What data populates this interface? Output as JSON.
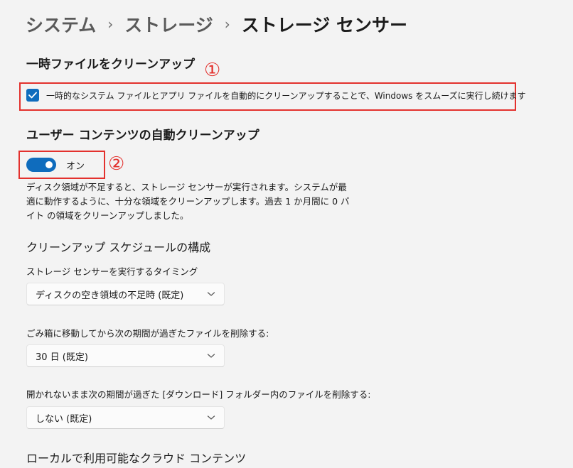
{
  "breadcrumb": {
    "items": [
      "システム",
      "ストレージ",
      "ストレージ センサー"
    ],
    "separator": "›"
  },
  "temp_files": {
    "title": "一時ファイルをクリーンアップ",
    "checkbox_label": "一時的なシステム ファイルとアプリ ファイルを自動的にクリーンアップすることで、Windows をスムーズに実行し続けます",
    "checked": true,
    "annotation": "①"
  },
  "user_content": {
    "title": "ユーザー コンテンツの自動クリーンアップ",
    "toggle_label": "オン",
    "toggle_on": true,
    "annotation": "②",
    "description": "ディスク領域が不足すると、ストレージ センサーが実行されます。システムが最適に動作するように、十分な領域をクリーンアップします。過去 1 か月間に 0 バイト の領域をクリーンアップしました。"
  },
  "schedule": {
    "title": "クリーンアップ スケジュールの構成",
    "run_timing": {
      "label": "ストレージ センサーを実行するタイミング",
      "value": "ディスクの空き領域の不足時 (既定)"
    },
    "recycle_bin": {
      "label": "ごみ箱に移動してから次の期間が過ぎたファイルを削除する:",
      "value": "30 日 (既定)"
    },
    "downloads": {
      "label": "開かれないまま次の期間が過ぎた [ダウンロード] フォルダー内のファイルを削除する:",
      "value": "しない (既定)"
    }
  },
  "cloud": {
    "title": "ローカルで利用可能なクラウド コンテンツ"
  },
  "colors": {
    "accent": "#0f6cbd",
    "annotation_red": "#e3312d",
    "background": "#f3f3f3"
  }
}
